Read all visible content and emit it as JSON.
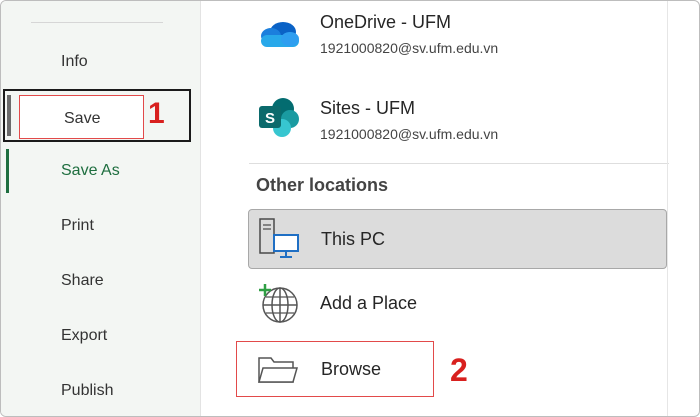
{
  "nav": {
    "items": [
      {
        "label": "Info"
      },
      {
        "label": "Save"
      },
      {
        "label": "Save As"
      },
      {
        "label": "Print"
      },
      {
        "label": "Share"
      },
      {
        "label": "Export"
      },
      {
        "label": "Publish"
      }
    ]
  },
  "locations": {
    "onedrive": {
      "title": "OneDrive - UFM",
      "account": "1921000820@sv.ufm.edu.vn",
      "icon": "onedrive-cloud-icon"
    },
    "sites": {
      "title": "Sites - UFM",
      "account": "1921000820@sv.ufm.edu.vn",
      "icon": "sharepoint-sites-icon"
    }
  },
  "other_locations": {
    "heading": "Other locations",
    "this_pc": {
      "label": "This PC",
      "icon": "computer-icon"
    },
    "add_place": {
      "label": "Add a Place",
      "icon": "globe-add-icon"
    },
    "browse": {
      "label": "Browse",
      "icon": "folder-icon"
    }
  },
  "annotations": {
    "step1": "1",
    "step2": "2",
    "color": "#d8201e"
  }
}
